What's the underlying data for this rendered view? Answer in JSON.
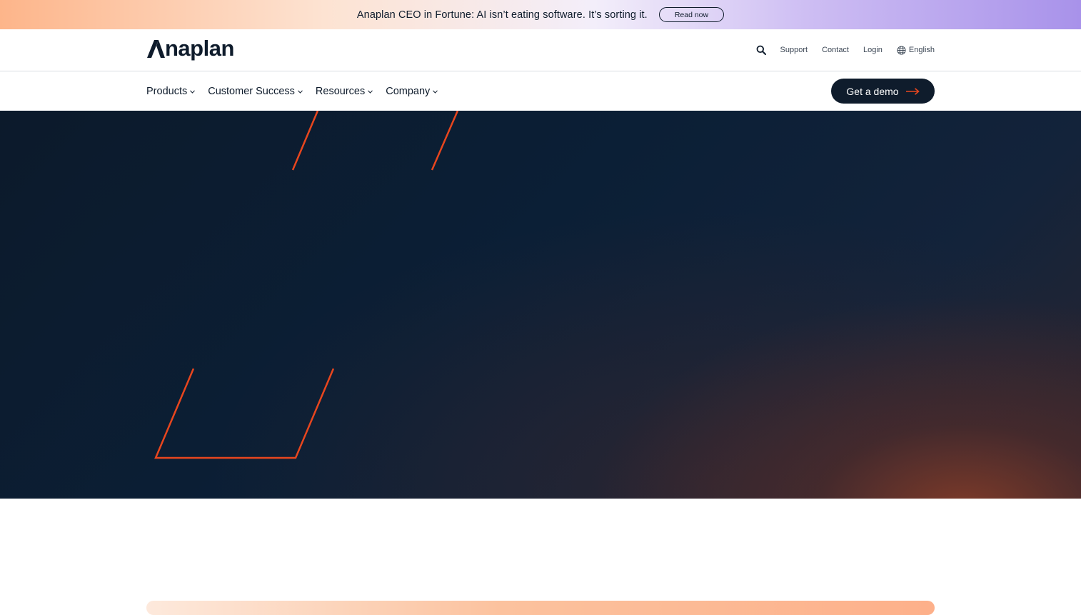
{
  "announcement": {
    "text": "Anaplan CEO in Fortune: AI isn’t eating software. It’s sorting it.",
    "cta_label": "Read now"
  },
  "header": {
    "logo_text": "Anaplan",
    "utility_links": [
      "Support",
      "Contact",
      "Login"
    ],
    "language": "English",
    "search_icon": "search-icon",
    "globe_icon": "globe-icon"
  },
  "nav": {
    "items": [
      {
        "label": "Products"
      },
      {
        "label": "Customer Success"
      },
      {
        "label": "Resources"
      },
      {
        "label": "Company"
      }
    ],
    "demo_label": "Get a demo"
  },
  "colors": {
    "brand_navy": "#0f1c2c",
    "accent_orange": "#e8461e",
    "announcement_left": "#fdb58a",
    "announcement_right": "#a892ea"
  }
}
